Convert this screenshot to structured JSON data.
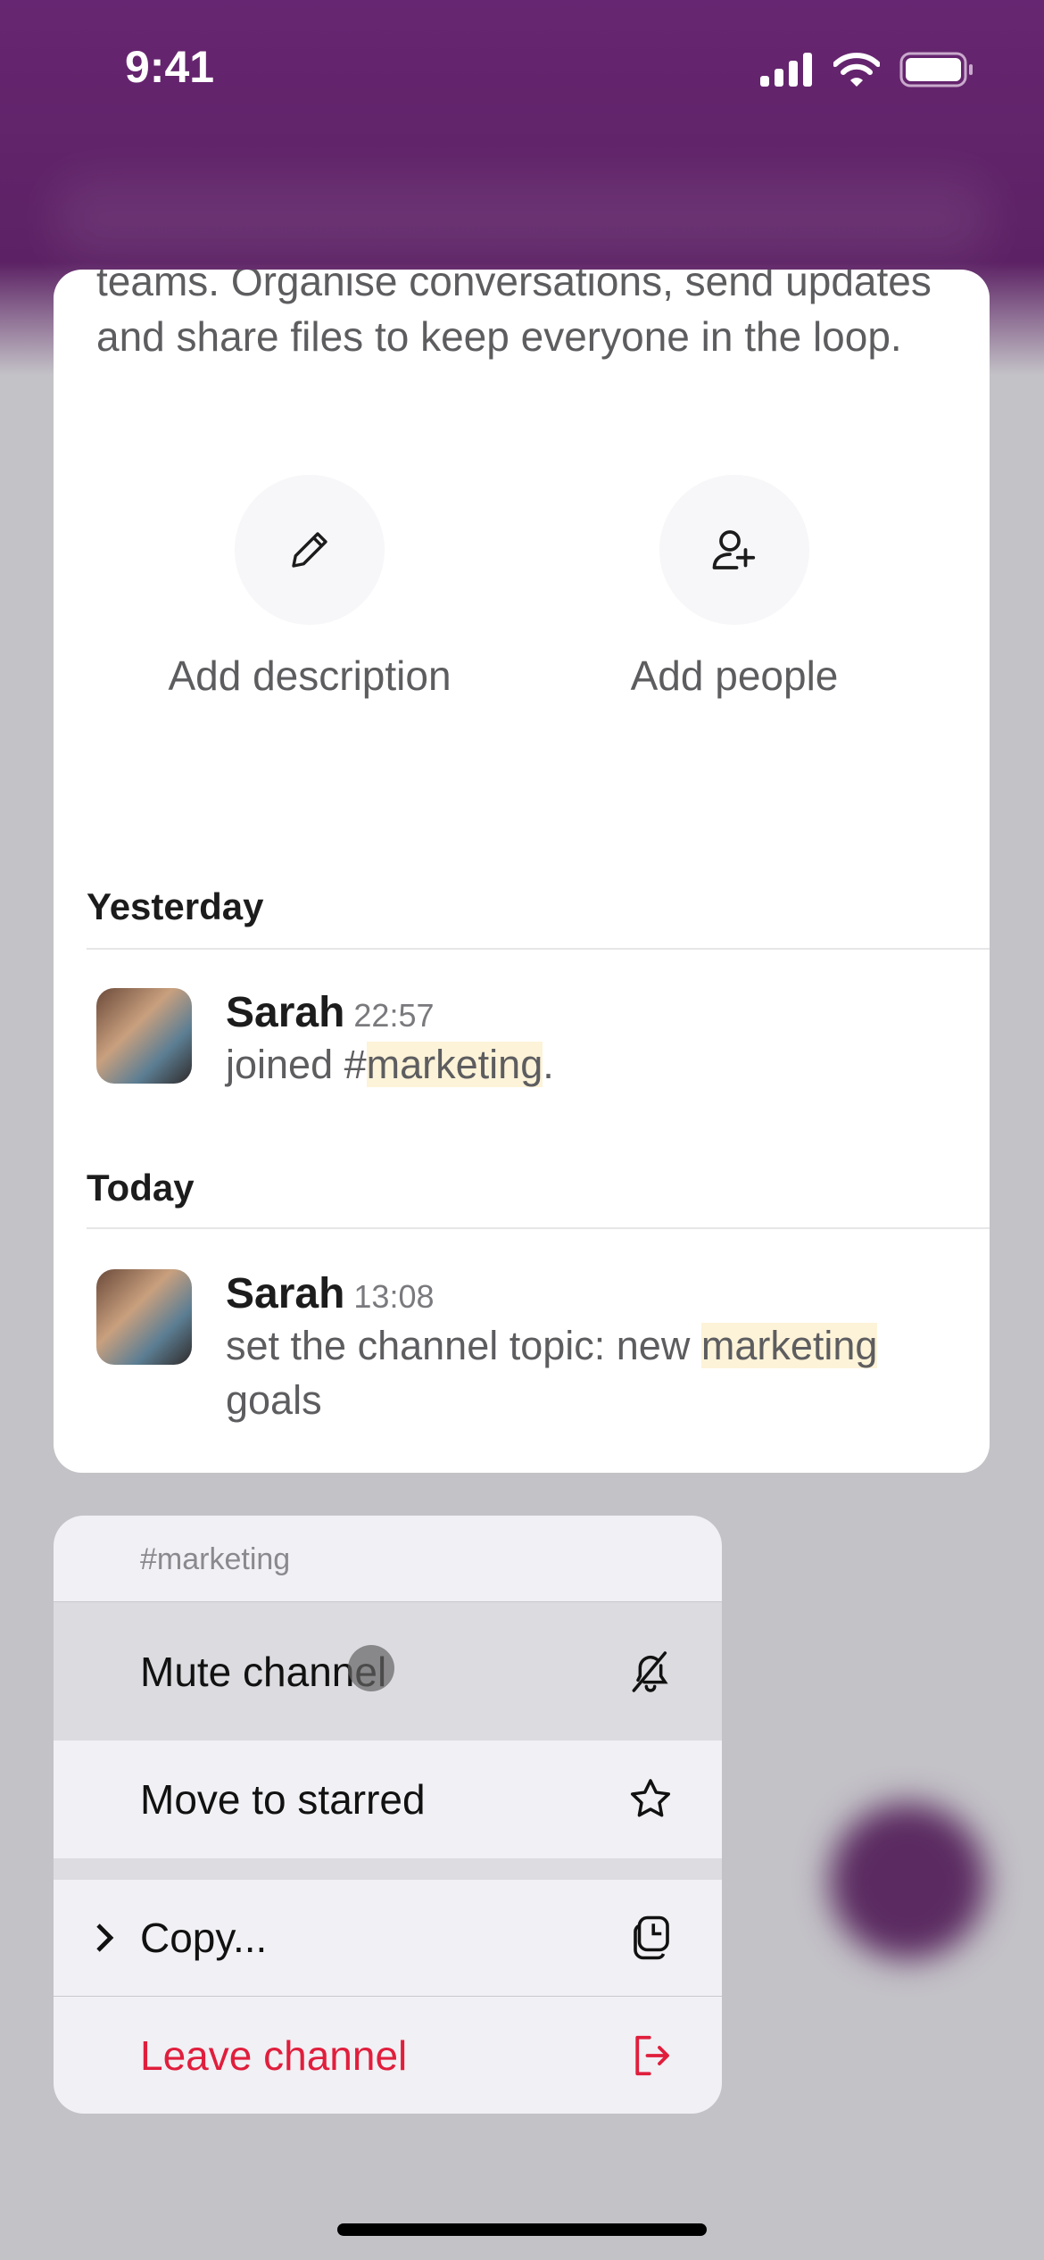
{
  "status_bar": {
    "time": "9:41"
  },
  "channel_intro": {
    "description": "teams. Organise conversations, send updates and share files to keep everyone in the loop.",
    "actions": [
      {
        "label": "Add description",
        "icon": "pencil-icon"
      },
      {
        "label": "Add people",
        "icon": "add-person-icon"
      }
    ]
  },
  "messages": [
    {
      "day": "Yesterday",
      "author": "Sarah",
      "time": "22:57",
      "text_before": "joined #",
      "highlight": "marketing",
      "text_after": "."
    },
    {
      "day": "Today",
      "author": "Sarah",
      "time": "13:08",
      "text_before": "set the channel topic: new ",
      "highlight": "marketing",
      "text_after": " goals"
    }
  ],
  "context_menu": {
    "title": "#marketing",
    "items": [
      {
        "label": "Mute channel",
        "icon": "bell-slash-icon"
      },
      {
        "label": "Move to starred",
        "icon": "star-icon"
      },
      {
        "label": "Copy...",
        "icon": "copy-icon"
      },
      {
        "label": "Leave channel",
        "icon": "leave-icon"
      }
    ],
    "colors": {
      "destructive": "#e01e3c",
      "highlight": "#dcdbe0"
    }
  },
  "colors": {
    "brand": "#632469"
  }
}
